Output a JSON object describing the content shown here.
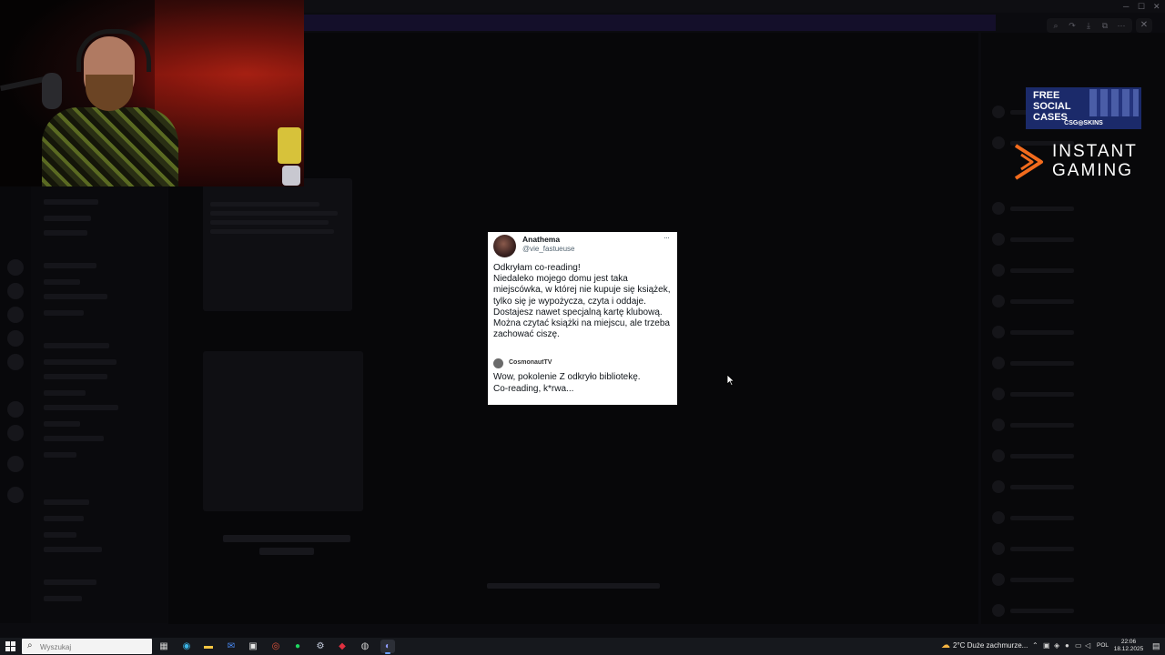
{
  "tweet": {
    "author_name": "Anathema",
    "author_handle": "@vie_fastueuse",
    "more": "···",
    "body": "Odkryłam co-reading!\nNiedaleko mojego domu jest taka miejscówka, w której nie kupuje się książek, tylko się je wypożycza, czyta i oddaje. Dostajesz nawet specjalną kartę klubową. Można czytać książki na miejscu, ale trzeba zachować ciszę.",
    "quote_author": "CosmonautTV",
    "quote_text": "Wow, pokolenie Z odkryło bibliotekę.\nCo-reading, k*rwa..."
  },
  "ads": {
    "free_cases": "FREE SOCIAL CASES",
    "free_cases_brand": "CSG◎SKINS",
    "instant_line1": "INSTANT",
    "instant_line2": "GAMING"
  },
  "taskbar": {
    "search_placeholder": "Wyszukaj",
    "weather": "2°C  Duże zachmurze...",
    "language": "POL",
    "time": "22:06",
    "date": "18.12.2025"
  },
  "colors": {
    "accent": "#6aa0ff",
    "instant_gaming_orange": "#f26b1d",
    "ad_blue": "#1b2a6a"
  }
}
